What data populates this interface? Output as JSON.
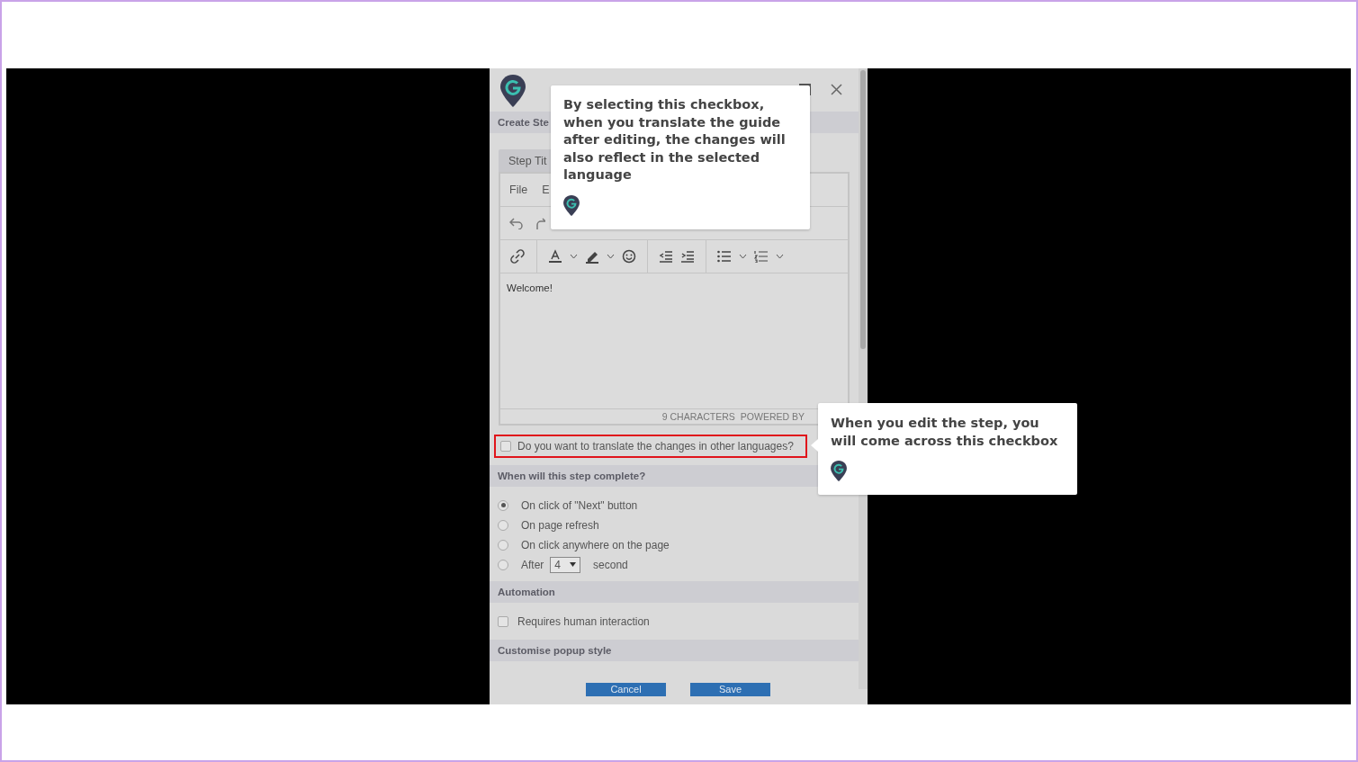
{
  "panel": {
    "header_label": "Create Ste",
    "editor": {
      "tab": "Step Tit",
      "menu": [
        "File",
        "E"
      ],
      "content": "Welcome!",
      "status": [
        "9 CHARACTERS",
        "POWERED BY"
      ]
    },
    "translate_option": {
      "label": "Do you want to translate the changes in other languages?",
      "checked": false,
      "highlighted": true
    },
    "completion": {
      "title": "When will this step complete?",
      "options": [
        {
          "kind": "plain",
          "label": "On click of \"Next\" button",
          "selected": true
        },
        {
          "kind": "plain",
          "label": "On page refresh",
          "selected": false
        },
        {
          "kind": "plain",
          "label": "On click anywhere on the page",
          "selected": false
        },
        {
          "kind": "delay",
          "label": "After",
          "value": "4",
          "suffix": "second",
          "selected": false
        }
      ]
    },
    "automation": {
      "title": "Automation",
      "options": [
        {
          "label": "Requires human interaction",
          "checked": false
        }
      ]
    },
    "style_section": {
      "title": "Customise popup style"
    },
    "buttons": [
      "Cancel",
      "Save"
    ]
  },
  "tooltips": [
    {
      "text": "By selecting this checkbox, when you translate the guide after editing, the changes will also reflect in the selected language"
    },
    {
      "text": "When you edit the step, you will come across this checkbox"
    }
  ]
}
